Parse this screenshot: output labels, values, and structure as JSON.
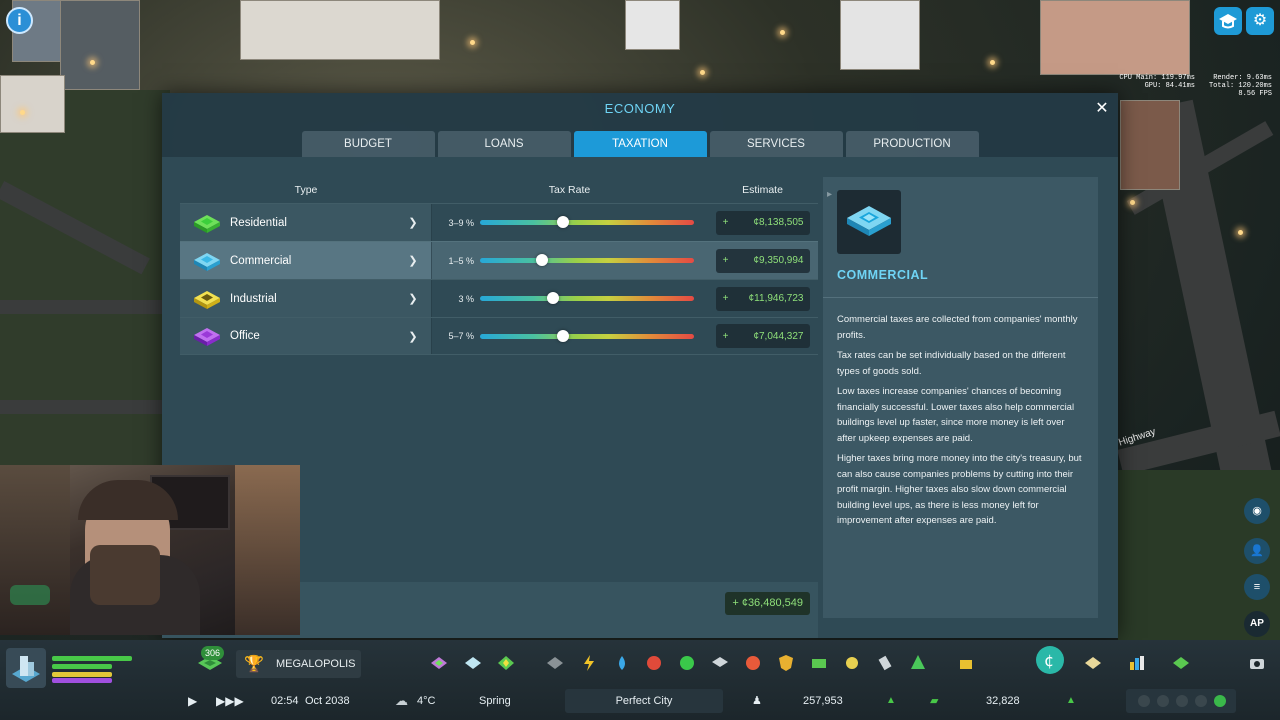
{
  "game": {
    "debug": {
      "cpu_main": "CPU Main: 119.97ms",
      "gpu": "GPU: 84.41ms",
      "render": "Render:  9.63ms",
      "total": "Total: 120.20ms",
      "fps": "8.56 FPS"
    },
    "street_names": [
      "Highway",
      "Highway"
    ]
  },
  "economy": {
    "title": "ECONOMY",
    "tabs": [
      {
        "label": "BUDGET",
        "active": false
      },
      {
        "label": "LOANS",
        "active": false
      },
      {
        "label": "TAXATION",
        "active": true
      },
      {
        "label": "SERVICES",
        "active": false
      },
      {
        "label": "PRODUCTION",
        "active": false
      }
    ],
    "columns": {
      "type": "Type",
      "rate": "Tax Rate",
      "estimate": "Estimate"
    },
    "rows": [
      {
        "type": "Residential",
        "rate": "3–9 %",
        "rate_value": 0.39,
        "sign": "+",
        "estimate": "¢8,138,505",
        "color": "#3ccf3c"
      },
      {
        "type": "Commercial",
        "rate": "1–5 %",
        "rate_value": 0.29,
        "sign": "+",
        "estimate": "¢9,350,994",
        "color": "#3ab8e6"
      },
      {
        "type": "Industrial",
        "rate": "3 %",
        "rate_value": 0.34,
        "sign": "+",
        "estimate": "¢11,946,723",
        "color": "#e8c820"
      },
      {
        "type": "Office",
        "rate": "5–7 %",
        "rate_value": 0.39,
        "sign": "+",
        "estimate": "¢7,044,327",
        "color": "#9a3ad8"
      }
    ],
    "total": "+ ¢36,480,549",
    "detail": {
      "title": "COMMERCIAL",
      "paragraphs": [
        "Commercial taxes are collected from companies' monthly profits.",
        "Tax rates can be set individually based on the different types of goods sold.",
        "Low taxes increase companies' chances of becoming financially successful. Lower taxes also help commercial buildings level up faster, since more money is left over after upkeep expenses are paid.",
        "Higher taxes bring more money into the city's treasury, but can also cause companies problems by cutting into their profit margin. Higher taxes also slow down commercial building level ups, as there is less money left for improvement after expenses are paid."
      ]
    }
  },
  "bottom_bar": {
    "milestone_badge": "306",
    "milestone_name": "MEGALOPOLIS",
    "time": "02:54",
    "date": "Oct 2038",
    "temperature": "4°C",
    "season": "Spring",
    "city_name": "Perfect City",
    "population": "257,953",
    "money": "32,828"
  },
  "right_tools": {
    "ap_label": "AP"
  },
  "colors": {
    "accent": "#1d9ad8",
    "title": "#6fd4f5",
    "positive": "#8fe07a"
  }
}
